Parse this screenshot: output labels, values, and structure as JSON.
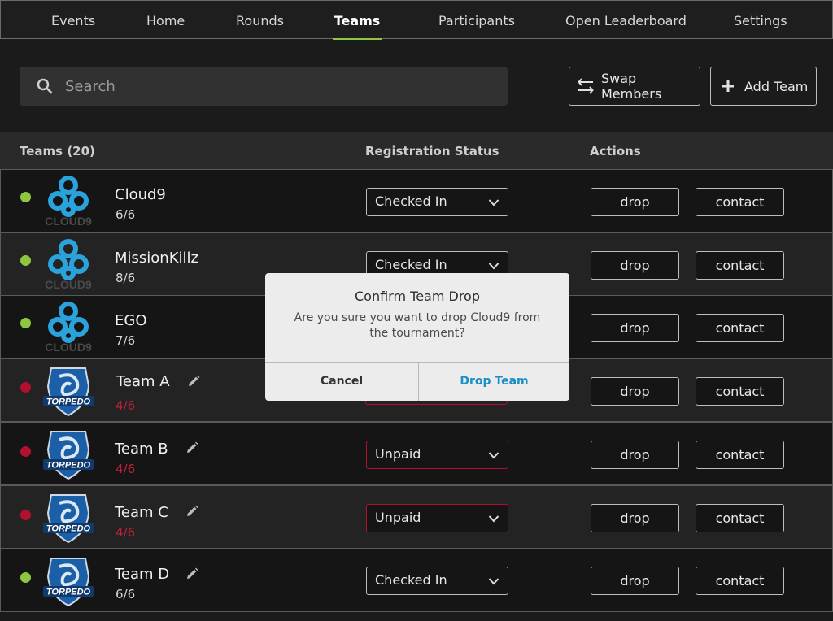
{
  "nav": {
    "tabs": [
      {
        "label": "Events"
      },
      {
        "label": "Home"
      },
      {
        "label": "Rounds"
      },
      {
        "label": "Teams",
        "active": true
      },
      {
        "label": "Participants"
      },
      {
        "label": "Open Leaderboard"
      },
      {
        "label": "Settings"
      }
    ]
  },
  "toolbar": {
    "search_placeholder": "Search",
    "swap_label": "Swap Members",
    "add_label": "Add Team"
  },
  "table": {
    "headers": {
      "teams": "Teams (20)",
      "status": "Registration Status",
      "actions": "Actions"
    },
    "rows": [
      {
        "name": "Cloud9",
        "count": "6/6",
        "status": "Checked In",
        "ok": true,
        "logo": "cloud9-logo",
        "editable": false
      },
      {
        "name": "MissionKillz",
        "count": "8/6",
        "status": "Checked In",
        "ok": true,
        "logo": "cloud9-logo",
        "editable": false
      },
      {
        "name": "EGO",
        "count": "7/6",
        "status": "",
        "ok": true,
        "logo": "cloud9-logo",
        "editable": false
      },
      {
        "name": "Team A",
        "count": "4/6",
        "status": "",
        "ok": false,
        "logo": "torpedo-logo",
        "editable": true
      },
      {
        "name": "Team B",
        "count": "4/6",
        "status": "Unpaid",
        "ok": false,
        "logo": "torpedo-logo",
        "editable": true
      },
      {
        "name": "Team C",
        "count": "4/6",
        "status": "Unpaid",
        "ok": false,
        "logo": "torpedo-logo",
        "editable": true
      },
      {
        "name": "Team D",
        "count": "6/6",
        "status": "Checked In",
        "ok": true,
        "logo": "torpedo-logo",
        "editable": true
      }
    ],
    "drop_label": "drop",
    "contact_label": "contact"
  },
  "modal": {
    "title": "Confirm Team Drop",
    "message": "Are you sure you want to drop Cloud9 from the tournament?",
    "cancel_label": "Cancel",
    "confirm_label": "Drop Team"
  },
  "colors": {
    "accent_green": "#8dc63f",
    "status_red": "#b2102f",
    "link_blue": "#1d8fc4",
    "cloud9_blue": "#2aa3dd",
    "torpedo_blue": "#1b5fa8"
  },
  "logos": {
    "cloud9_text": "CLOUD9",
    "torpedo_text": "TORPEDO"
  }
}
